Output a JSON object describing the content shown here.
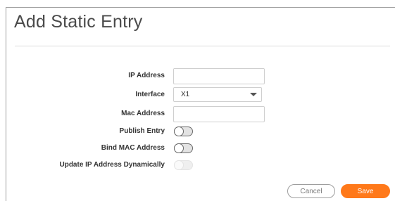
{
  "dialog": {
    "title": "Add Static Entry"
  },
  "form": {
    "ip_address_label": "IP Address",
    "ip_address_value": "",
    "interface_label": "Interface",
    "interface_value": "X1",
    "mac_address_label": "Mac Address",
    "mac_address_value": "",
    "publish_entry_label": "Publish Entry",
    "publish_entry_on": false,
    "bind_mac_label": "Bind MAC Address",
    "bind_mac_on": false,
    "update_ip_label": "Update IP Address Dynamically",
    "update_ip_on": false,
    "update_ip_enabled": false
  },
  "buttons": {
    "cancel_label": "Cancel",
    "save_label": "Save"
  },
  "colors": {
    "accent": "#ff791a",
    "title_text": "#4a4a4a"
  }
}
